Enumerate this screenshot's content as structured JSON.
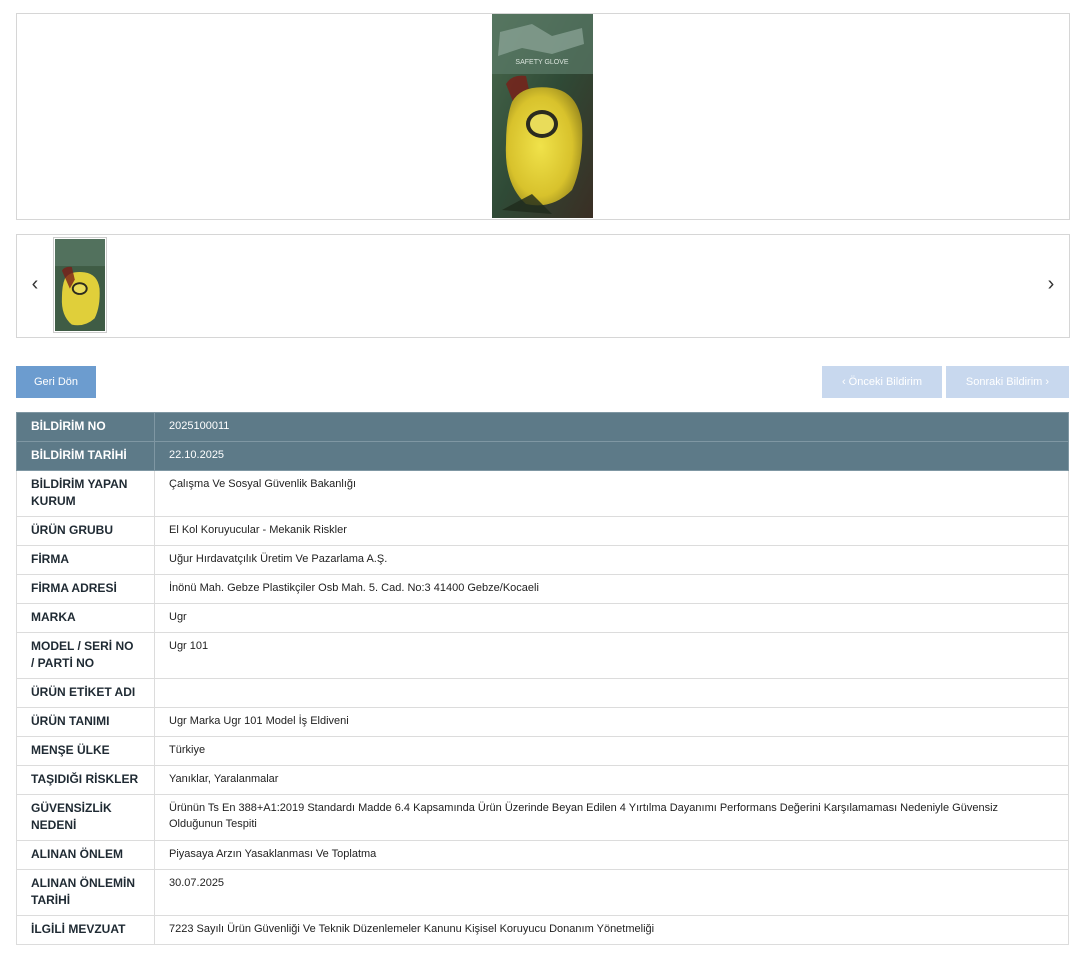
{
  "gallery": {
    "main_image": {
      "alt": "Ugr 101 iş eldiveni ambalajı",
      "brand_text": "SAFETY GLOVE"
    },
    "prev_arrow": "‹",
    "next_arrow": "›"
  },
  "actions": {
    "back_label": "Geri Dön",
    "prev_label": "‹ Önceki Bildirim",
    "next_label": "Sonraki Bildirim ›"
  },
  "details": {
    "rows": [
      {
        "label": "BİLDİRİM NO",
        "value": "2025100011"
      },
      {
        "label": "BİLDİRİM TARİHİ",
        "value": "22.10.2025"
      },
      {
        "label": "BİLDİRİM YAPAN KURUM",
        "value": "Çalışma Ve Sosyal Güvenlik Bakanlığı"
      },
      {
        "label": "ÜRÜN GRUBU",
        "value": "El Kol Koruyucular - Mekanik Riskler"
      },
      {
        "label": "FİRMA",
        "value": "Uğur Hırdavatçılık Üretim Ve Pazarlama A.Ş."
      },
      {
        "label": "FİRMA ADRESİ",
        "value": "İnönü Mah. Gebze Plastikçiler Osb Mah. 5. Cad. No:3 41400 Gebze/Kocaeli"
      },
      {
        "label": "MARKA",
        "value": "Ugr"
      },
      {
        "label": "MODEL / SERİ NO / PARTİ NO",
        "value": "Ugr 101"
      },
      {
        "label": "ÜRÜN ETİKET ADI",
        "value": ""
      },
      {
        "label": "ÜRÜN TANIMI",
        "value": "Ugr Marka Ugr 101 Model İş Eldiveni"
      },
      {
        "label": "MENŞE ÜLKE",
        "value": "Türkiye"
      },
      {
        "label": "TAŞIDIĞI RİSKLER",
        "value": "Yanıklar, Yaralanmalar"
      },
      {
        "label": "GÜVENSİZLİK NEDENİ",
        "value": "Ürünün Ts En 388+A1:2019 Standardı Madde 6.4 Kapsamında Ürün Üzerinde Beyan Edilen 4 Yırtılma Dayanımı Performans Değerini Karşılamaması Nedeniyle Güvensiz Olduğunun Tespiti"
      },
      {
        "label": "ALINAN ÖNLEM",
        "value": "Piyasaya Arzın Yasaklanması Ve Toplatma"
      },
      {
        "label": "ALINAN ÖNLEMİN TARİHİ",
        "value": "30.07.2025"
      },
      {
        "label": "İLGİLİ MEVZUAT",
        "value": "7223 Sayılı Ürün Güvenliği Ve Teknik Düzenlemeler Kanunu Kişisel Koruyucu Donanım Yönetmeliği"
      }
    ]
  }
}
